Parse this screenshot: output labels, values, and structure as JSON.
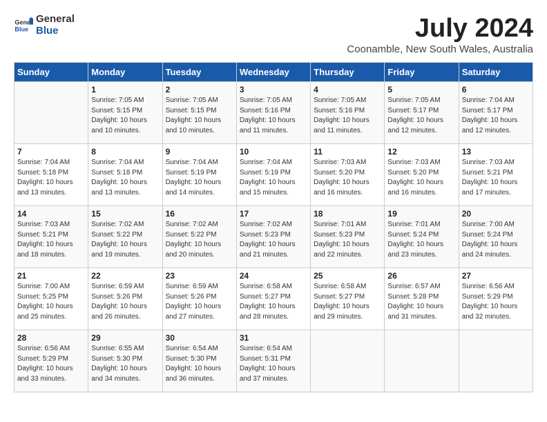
{
  "header": {
    "logo_general": "General",
    "logo_blue": "Blue",
    "title": "July 2024",
    "subtitle": "Coonamble, New South Wales, Australia"
  },
  "calendar": {
    "weekdays": [
      "Sunday",
      "Monday",
      "Tuesday",
      "Wednesday",
      "Thursday",
      "Friday",
      "Saturday"
    ],
    "weeks": [
      [
        {
          "day": "",
          "info": ""
        },
        {
          "day": "1",
          "info": "Sunrise: 7:05 AM\nSunset: 5:15 PM\nDaylight: 10 hours\nand 10 minutes."
        },
        {
          "day": "2",
          "info": "Sunrise: 7:05 AM\nSunset: 5:15 PM\nDaylight: 10 hours\nand 10 minutes."
        },
        {
          "day": "3",
          "info": "Sunrise: 7:05 AM\nSunset: 5:16 PM\nDaylight: 10 hours\nand 11 minutes."
        },
        {
          "day": "4",
          "info": "Sunrise: 7:05 AM\nSunset: 5:16 PM\nDaylight: 10 hours\nand 11 minutes."
        },
        {
          "day": "5",
          "info": "Sunrise: 7:05 AM\nSunset: 5:17 PM\nDaylight: 10 hours\nand 12 minutes."
        },
        {
          "day": "6",
          "info": "Sunrise: 7:04 AM\nSunset: 5:17 PM\nDaylight: 10 hours\nand 12 minutes."
        }
      ],
      [
        {
          "day": "7",
          "info": "Sunrise: 7:04 AM\nSunset: 5:18 PM\nDaylight: 10 hours\nand 13 minutes."
        },
        {
          "day": "8",
          "info": "Sunrise: 7:04 AM\nSunset: 5:18 PM\nDaylight: 10 hours\nand 13 minutes."
        },
        {
          "day": "9",
          "info": "Sunrise: 7:04 AM\nSunset: 5:19 PM\nDaylight: 10 hours\nand 14 minutes."
        },
        {
          "day": "10",
          "info": "Sunrise: 7:04 AM\nSunset: 5:19 PM\nDaylight: 10 hours\nand 15 minutes."
        },
        {
          "day": "11",
          "info": "Sunrise: 7:03 AM\nSunset: 5:20 PM\nDaylight: 10 hours\nand 16 minutes."
        },
        {
          "day": "12",
          "info": "Sunrise: 7:03 AM\nSunset: 5:20 PM\nDaylight: 10 hours\nand 16 minutes."
        },
        {
          "day": "13",
          "info": "Sunrise: 7:03 AM\nSunset: 5:21 PM\nDaylight: 10 hours\nand 17 minutes."
        }
      ],
      [
        {
          "day": "14",
          "info": "Sunrise: 7:03 AM\nSunset: 5:21 PM\nDaylight: 10 hours\nand 18 minutes."
        },
        {
          "day": "15",
          "info": "Sunrise: 7:02 AM\nSunset: 5:22 PM\nDaylight: 10 hours\nand 19 minutes."
        },
        {
          "day": "16",
          "info": "Sunrise: 7:02 AM\nSunset: 5:22 PM\nDaylight: 10 hours\nand 20 minutes."
        },
        {
          "day": "17",
          "info": "Sunrise: 7:02 AM\nSunset: 5:23 PM\nDaylight: 10 hours\nand 21 minutes."
        },
        {
          "day": "18",
          "info": "Sunrise: 7:01 AM\nSunset: 5:23 PM\nDaylight: 10 hours\nand 22 minutes."
        },
        {
          "day": "19",
          "info": "Sunrise: 7:01 AM\nSunset: 5:24 PM\nDaylight: 10 hours\nand 23 minutes."
        },
        {
          "day": "20",
          "info": "Sunrise: 7:00 AM\nSunset: 5:24 PM\nDaylight: 10 hours\nand 24 minutes."
        }
      ],
      [
        {
          "day": "21",
          "info": "Sunrise: 7:00 AM\nSunset: 5:25 PM\nDaylight: 10 hours\nand 25 minutes."
        },
        {
          "day": "22",
          "info": "Sunrise: 6:59 AM\nSunset: 5:26 PM\nDaylight: 10 hours\nand 26 minutes."
        },
        {
          "day": "23",
          "info": "Sunrise: 6:59 AM\nSunset: 5:26 PM\nDaylight: 10 hours\nand 27 minutes."
        },
        {
          "day": "24",
          "info": "Sunrise: 6:58 AM\nSunset: 5:27 PM\nDaylight: 10 hours\nand 28 minutes."
        },
        {
          "day": "25",
          "info": "Sunrise: 6:58 AM\nSunset: 5:27 PM\nDaylight: 10 hours\nand 29 minutes."
        },
        {
          "day": "26",
          "info": "Sunrise: 6:57 AM\nSunset: 5:28 PM\nDaylight: 10 hours\nand 31 minutes."
        },
        {
          "day": "27",
          "info": "Sunrise: 6:56 AM\nSunset: 5:29 PM\nDaylight: 10 hours\nand 32 minutes."
        }
      ],
      [
        {
          "day": "28",
          "info": "Sunrise: 6:56 AM\nSunset: 5:29 PM\nDaylight: 10 hours\nand 33 minutes."
        },
        {
          "day": "29",
          "info": "Sunrise: 6:55 AM\nSunset: 5:30 PM\nDaylight: 10 hours\nand 34 minutes."
        },
        {
          "day": "30",
          "info": "Sunrise: 6:54 AM\nSunset: 5:30 PM\nDaylight: 10 hours\nand 36 minutes."
        },
        {
          "day": "31",
          "info": "Sunrise: 6:54 AM\nSunset: 5:31 PM\nDaylight: 10 hours\nand 37 minutes."
        },
        {
          "day": "",
          "info": ""
        },
        {
          "day": "",
          "info": ""
        },
        {
          "day": "",
          "info": ""
        }
      ]
    ]
  }
}
